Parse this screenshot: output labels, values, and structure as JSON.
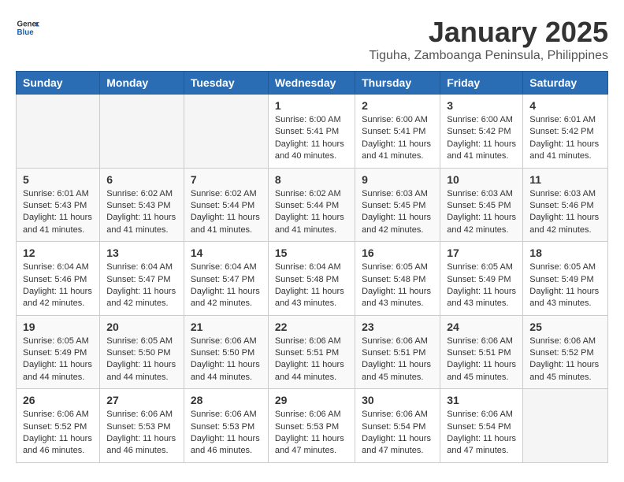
{
  "app": {
    "name_general": "General",
    "name_blue": "Blue"
  },
  "title": "January 2025",
  "subtitle": "Tiguha, Zamboanga Peninsula, Philippines",
  "days_of_week": [
    "Sunday",
    "Monday",
    "Tuesday",
    "Wednesday",
    "Thursday",
    "Friday",
    "Saturday"
  ],
  "weeks": [
    [
      {
        "day": "",
        "content": ""
      },
      {
        "day": "",
        "content": ""
      },
      {
        "day": "",
        "content": ""
      },
      {
        "day": "1",
        "content": "Sunrise: 6:00 AM\nSunset: 5:41 PM\nDaylight: 11 hours and 40 minutes."
      },
      {
        "day": "2",
        "content": "Sunrise: 6:00 AM\nSunset: 5:41 PM\nDaylight: 11 hours and 41 minutes."
      },
      {
        "day": "3",
        "content": "Sunrise: 6:00 AM\nSunset: 5:42 PM\nDaylight: 11 hours and 41 minutes."
      },
      {
        "day": "4",
        "content": "Sunrise: 6:01 AM\nSunset: 5:42 PM\nDaylight: 11 hours and 41 minutes."
      }
    ],
    [
      {
        "day": "5",
        "content": "Sunrise: 6:01 AM\nSunset: 5:43 PM\nDaylight: 11 hours and 41 minutes."
      },
      {
        "day": "6",
        "content": "Sunrise: 6:02 AM\nSunset: 5:43 PM\nDaylight: 11 hours and 41 minutes."
      },
      {
        "day": "7",
        "content": "Sunrise: 6:02 AM\nSunset: 5:44 PM\nDaylight: 11 hours and 41 minutes."
      },
      {
        "day": "8",
        "content": "Sunrise: 6:02 AM\nSunset: 5:44 PM\nDaylight: 11 hours and 41 minutes."
      },
      {
        "day": "9",
        "content": "Sunrise: 6:03 AM\nSunset: 5:45 PM\nDaylight: 11 hours and 42 minutes."
      },
      {
        "day": "10",
        "content": "Sunrise: 6:03 AM\nSunset: 5:45 PM\nDaylight: 11 hours and 42 minutes."
      },
      {
        "day": "11",
        "content": "Sunrise: 6:03 AM\nSunset: 5:46 PM\nDaylight: 11 hours and 42 minutes."
      }
    ],
    [
      {
        "day": "12",
        "content": "Sunrise: 6:04 AM\nSunset: 5:46 PM\nDaylight: 11 hours and 42 minutes."
      },
      {
        "day": "13",
        "content": "Sunrise: 6:04 AM\nSunset: 5:47 PM\nDaylight: 11 hours and 42 minutes."
      },
      {
        "day": "14",
        "content": "Sunrise: 6:04 AM\nSunset: 5:47 PM\nDaylight: 11 hours and 42 minutes."
      },
      {
        "day": "15",
        "content": "Sunrise: 6:04 AM\nSunset: 5:48 PM\nDaylight: 11 hours and 43 minutes."
      },
      {
        "day": "16",
        "content": "Sunrise: 6:05 AM\nSunset: 5:48 PM\nDaylight: 11 hours and 43 minutes."
      },
      {
        "day": "17",
        "content": "Sunrise: 6:05 AM\nSunset: 5:49 PM\nDaylight: 11 hours and 43 minutes."
      },
      {
        "day": "18",
        "content": "Sunrise: 6:05 AM\nSunset: 5:49 PM\nDaylight: 11 hours and 43 minutes."
      }
    ],
    [
      {
        "day": "19",
        "content": "Sunrise: 6:05 AM\nSunset: 5:49 PM\nDaylight: 11 hours and 44 minutes."
      },
      {
        "day": "20",
        "content": "Sunrise: 6:05 AM\nSunset: 5:50 PM\nDaylight: 11 hours and 44 minutes."
      },
      {
        "day": "21",
        "content": "Sunrise: 6:06 AM\nSunset: 5:50 PM\nDaylight: 11 hours and 44 minutes."
      },
      {
        "day": "22",
        "content": "Sunrise: 6:06 AM\nSunset: 5:51 PM\nDaylight: 11 hours and 44 minutes."
      },
      {
        "day": "23",
        "content": "Sunrise: 6:06 AM\nSunset: 5:51 PM\nDaylight: 11 hours and 45 minutes."
      },
      {
        "day": "24",
        "content": "Sunrise: 6:06 AM\nSunset: 5:51 PM\nDaylight: 11 hours and 45 minutes."
      },
      {
        "day": "25",
        "content": "Sunrise: 6:06 AM\nSunset: 5:52 PM\nDaylight: 11 hours and 45 minutes."
      }
    ],
    [
      {
        "day": "26",
        "content": "Sunrise: 6:06 AM\nSunset: 5:52 PM\nDaylight: 11 hours and 46 minutes."
      },
      {
        "day": "27",
        "content": "Sunrise: 6:06 AM\nSunset: 5:53 PM\nDaylight: 11 hours and 46 minutes."
      },
      {
        "day": "28",
        "content": "Sunrise: 6:06 AM\nSunset: 5:53 PM\nDaylight: 11 hours and 46 minutes."
      },
      {
        "day": "29",
        "content": "Sunrise: 6:06 AM\nSunset: 5:53 PM\nDaylight: 11 hours and 47 minutes."
      },
      {
        "day": "30",
        "content": "Sunrise: 6:06 AM\nSunset: 5:54 PM\nDaylight: 11 hours and 47 minutes."
      },
      {
        "day": "31",
        "content": "Sunrise: 6:06 AM\nSunset: 5:54 PM\nDaylight: 11 hours and 47 minutes."
      },
      {
        "day": "",
        "content": ""
      }
    ]
  ]
}
